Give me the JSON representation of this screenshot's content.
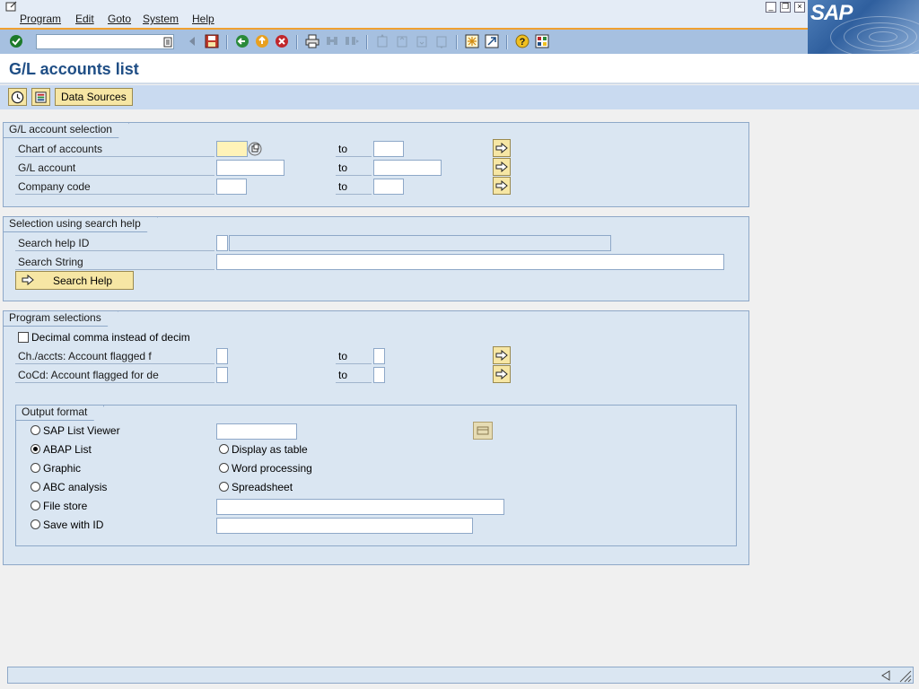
{
  "menu": {
    "items": [
      "Program",
      "Edit",
      "Goto",
      "System",
      "Help"
    ]
  },
  "toolbar": {
    "command_field_value": ""
  },
  "page": {
    "title": "G/L accounts list"
  },
  "app_toolbar": {
    "data_sources_label": "Data Sources"
  },
  "gl_selection": {
    "title": "G/L account selection",
    "rows": [
      {
        "label": "Chart of accounts",
        "from": "",
        "to_label": "to",
        "to": ""
      },
      {
        "label": "G/L account",
        "from": "",
        "to_label": "to",
        "to": ""
      },
      {
        "label": "Company code",
        "from": "",
        "to_label": "to",
        "to": ""
      }
    ]
  },
  "search_help": {
    "title": "Selection using search help",
    "id_label": "Search help ID",
    "string_label": "Search String",
    "button_label": "Search Help"
  },
  "program_selections": {
    "title": "Program selections",
    "decimal_comma_label": "Decimal comma instead of decim",
    "rows": [
      {
        "label": "Ch./accts: Account flagged f",
        "to_label": "to"
      },
      {
        "label": "CoCd: Account flagged for de",
        "to_label": "to"
      }
    ]
  },
  "output_format": {
    "title": "Output format",
    "options_left": [
      {
        "label": "SAP List Viewer",
        "selected": false
      },
      {
        "label": "ABAP List",
        "selected": true
      },
      {
        "label": "Graphic",
        "selected": false
      },
      {
        "label": "ABC analysis",
        "selected": false
      },
      {
        "label": "File store",
        "selected": false
      },
      {
        "label": "Save with ID",
        "selected": false
      }
    ],
    "options_right": [
      {
        "label": "Display as table",
        "selected": false
      },
      {
        "label": "Word processing",
        "selected": false
      },
      {
        "label": "Spreadsheet",
        "selected": false
      }
    ]
  },
  "colors": {
    "accent_orange": "#f0a030",
    "title_blue": "#1f4e85",
    "group_bg": "#dae6f2",
    "button_yellow": "#f6e6a4"
  }
}
